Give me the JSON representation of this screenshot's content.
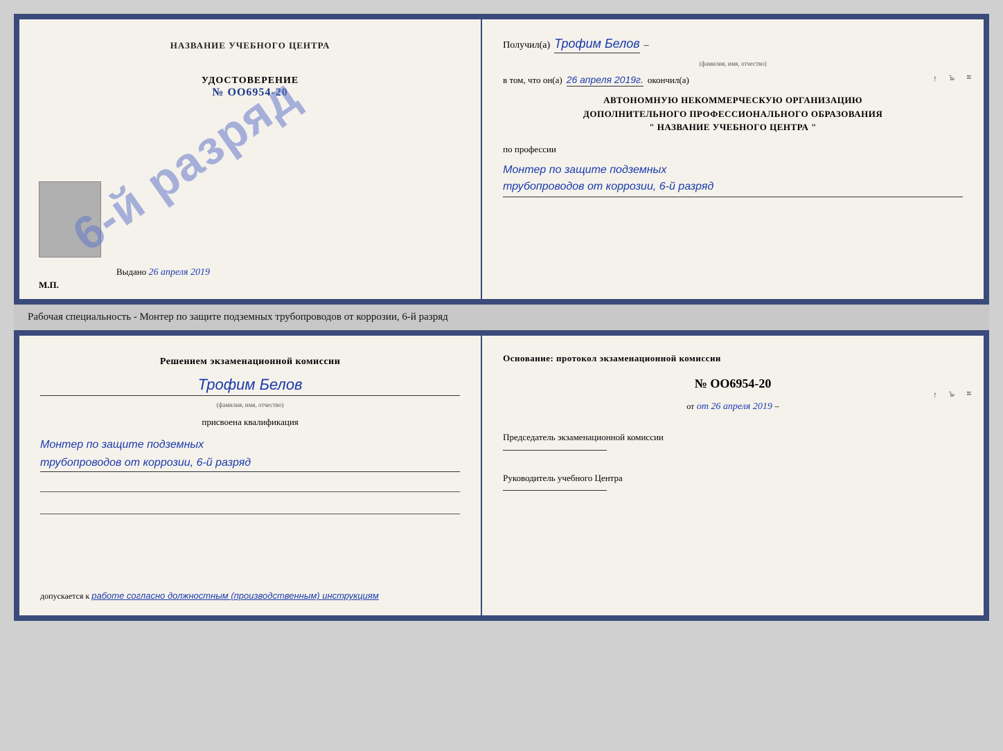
{
  "topCert": {
    "leftTitle": "НАЗВАНИЕ УЧЕБНОГО ЦЕНТРА",
    "stampText": "6-й разряд",
    "udostoverenie": "УДОСТОВЕРЕНИЕ",
    "number": "№ OO6954-20",
    "vydano": "Выдано",
    "vydanoDate": "26 апреля 2019",
    "mpLabel": "М.П.",
    "poluchilLabel": "Получил(а)",
    "recipientName": "Трофим Белов",
    "fioHint": "(фамилия, имя, отчество)",
    "vtomLabel": "в том, что он(а)",
    "vtomDate": "26 апреля 2019г.",
    "okonchilLabel": "окончил(а)",
    "orgLine1": "АВТОНОМНУЮ НЕКОММЕРЧЕСКУЮ ОРГАНИЗАЦИЮ",
    "orgLine2": "ДОПОЛНИТЕЛЬНОГО ПРОФЕССИОНАЛЬНОГО ОБРАЗОВАНИЯ",
    "orgLine3": "\"  НАЗВАНИЕ УЧЕБНОГО ЦЕНТРА  \"",
    "poProfessii": "по профессии",
    "profession1": "Монтер по защите подземных",
    "profession2": "трубопроводов от коррозии, 6-й разряд",
    "sideLetters": "и\n,а\n←"
  },
  "middleText": "Рабочая специальность - Монтер по защите подземных трубопроводов от коррозии, 6-й разряд",
  "bottomCert": {
    "resheniemTitle": "Решением экзаменационной комиссии",
    "recipientName": "Трофим Белов",
    "fioHint": "(фамилия, имя, отчество)",
    "prisvoenaLabel": "присвоена квалификация",
    "kvali1": "Монтер по защите подземных",
    "kvali2": "трубопроводов от коррозии, 6-й разряд",
    "dopuskaetsyaLabel": "допускается к",
    "dopuskaetsyaVal": "работе согласно должностным (производственным) инструкциям",
    "osnovanie": "Основание: протокол экзаменационной комиссии",
    "protocolNum": "№ OO6954-20",
    "otDate": "от 26 апреля 2019",
    "predsedatelLabel": "Председатель экзаменационной комиссии",
    "rukovoditelLabel": "Руководитель учебного Центра",
    "sideLetters": "и\n,а\n←"
  }
}
